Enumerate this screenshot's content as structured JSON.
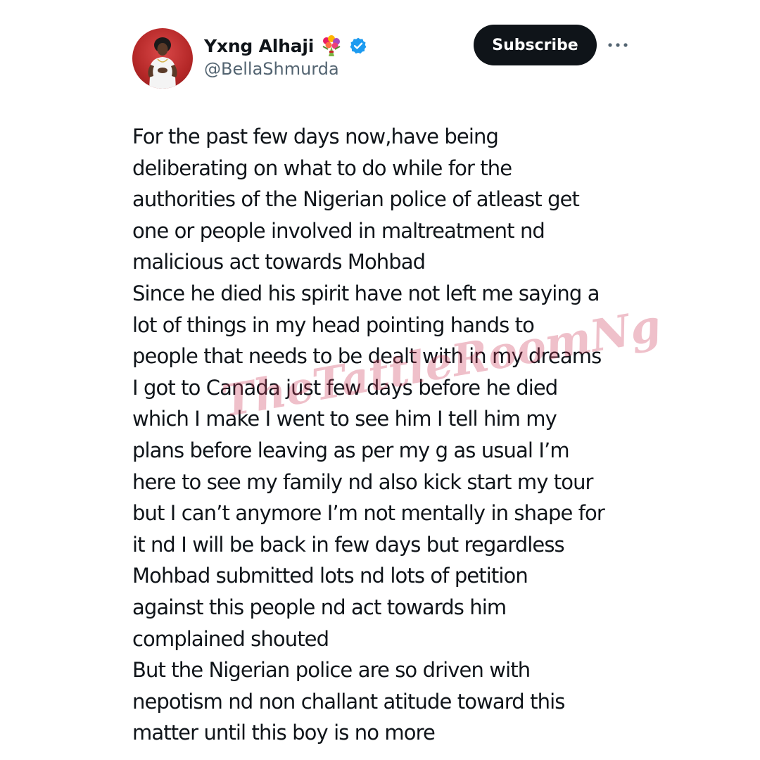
{
  "author": {
    "display_name": "Yxng Alhaji",
    "handle": "@BellaShmurda",
    "flower_emoji": "bouquet-icon",
    "verified": "verified-badge-icon",
    "accent_color": "#1d9bf0"
  },
  "actions": {
    "subscribe_label": "Subscribe",
    "more_icon": "more-horizontal-icon"
  },
  "tweet": {
    "lines": [
      "For the past few days now,have being",
      "deliberating on what to do while for the",
      "authorities of the Nigerian police of atleast get",
      "one or people involved in maltreatment nd",
      "malicious act towards Mohbad",
      "Since he died his spirit have not left me saying a",
      "lot of things in my head pointing hands to",
      "people that needs to be dealt with in my dreams",
      "I got to Canada just few days before he died",
      "which I make I went to see him I tell him my",
      "plans before leaving as per my g as usual I’m",
      "here to see my family nd also kick start my tour",
      "but I can’t anymore I’m not mentally in shape for",
      "it nd I will be back in few days but regardless",
      "Mohbad submitted lots nd lots of petition",
      "against this people nd act towards him",
      "complained shouted",
      "But the Nigerian police are so driven with",
      "nepotism nd non challant atitude toward this",
      "matter until this boy is no more"
    ]
  },
  "watermark": {
    "text": "TheTattleRoomNg"
  }
}
